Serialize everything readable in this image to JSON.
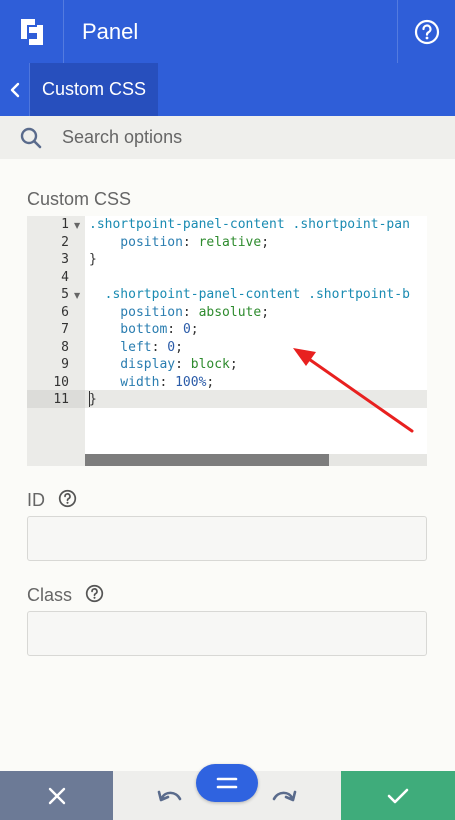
{
  "header": {
    "title": "Panel"
  },
  "subnav": {
    "tab_label": "Custom CSS"
  },
  "search": {
    "placeholder": "Search options"
  },
  "custom_css": {
    "label": "Custom CSS",
    "line_numbers": [
      "1",
      "2",
      "3",
      "4",
      "5",
      "6",
      "7",
      "8",
      "9",
      "10",
      "11"
    ],
    "lines": [
      [
        {
          "t": ".shortpoint-panel-content .shortpoint-pan",
          "c": "sel"
        }
      ],
      [
        {
          "t": "    position",
          "c": "prop"
        },
        {
          "t": ": ",
          "c": "pun"
        },
        {
          "t": "relative",
          "c": "val"
        },
        {
          "t": ";",
          "c": "pun"
        }
      ],
      [
        {
          "t": "}",
          "c": "pun"
        }
      ],
      [],
      [
        {
          "t": "  .shortpoint-panel-content .shortpoint-b",
          "c": "sel"
        }
      ],
      [
        {
          "t": "    position",
          "c": "prop"
        },
        {
          "t": ": ",
          "c": "pun"
        },
        {
          "t": "absolute",
          "c": "val"
        },
        {
          "t": ";",
          "c": "pun"
        }
      ],
      [
        {
          "t": "    bottom",
          "c": "prop"
        },
        {
          "t": ": ",
          "c": "pun"
        },
        {
          "t": "0",
          "c": "num"
        },
        {
          "t": ";",
          "c": "pun"
        }
      ],
      [
        {
          "t": "    left",
          "c": "prop"
        },
        {
          "t": ": ",
          "c": "pun"
        },
        {
          "t": "0",
          "c": "num"
        },
        {
          "t": ";",
          "c": "pun"
        }
      ],
      [
        {
          "t": "    display",
          "c": "prop"
        },
        {
          "t": ": ",
          "c": "pun"
        },
        {
          "t": "block",
          "c": "val"
        },
        {
          "t": ";",
          "c": "pun"
        }
      ],
      [
        {
          "t": "    width",
          "c": "prop"
        },
        {
          "t": ": ",
          "c": "pun"
        },
        {
          "t": "100%",
          "c": "num"
        },
        {
          "t": ";",
          "c": "pun"
        }
      ],
      [
        {
          "t": "}",
          "c": "pun"
        }
      ]
    ]
  },
  "id_field": {
    "label": "ID",
    "value": ""
  },
  "class_field": {
    "label": "Class",
    "value": ""
  },
  "colors": {
    "brand": "#2f5ed8",
    "cancel": "#6c7a96",
    "confirm": "#3fac7b",
    "annotation_arrow": "#e8201f"
  }
}
